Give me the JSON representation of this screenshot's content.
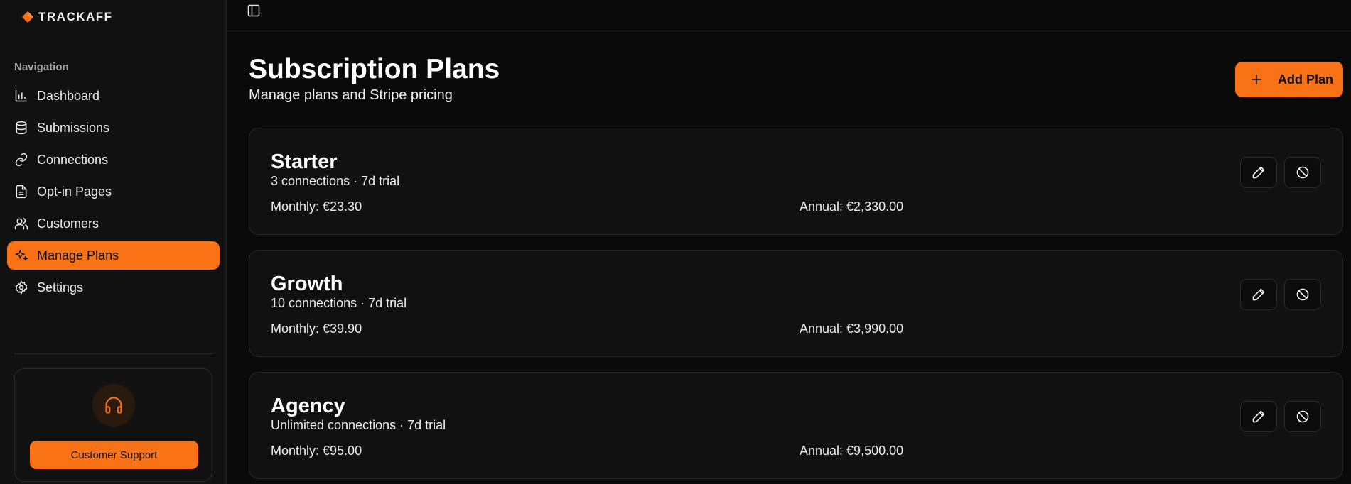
{
  "brand": {
    "name": "TRACKAFF",
    "accent": "#f97316"
  },
  "sidebar": {
    "heading": "Navigation",
    "items": [
      {
        "label": "Dashboard",
        "icon": "bar-chart-icon",
        "active": false
      },
      {
        "label": "Submissions",
        "icon": "database-icon",
        "active": false
      },
      {
        "label": "Connections",
        "icon": "link-icon",
        "active": false
      },
      {
        "label": "Opt-in Pages",
        "icon": "file-text-icon",
        "active": false
      },
      {
        "label": "Customers",
        "icon": "users-icon",
        "active": false
      },
      {
        "label": "Manage Plans",
        "icon": "sparkles-icon",
        "active": true
      },
      {
        "label": "Settings",
        "icon": "gear-icon",
        "active": false
      }
    ],
    "support": {
      "icon": "headphones-icon",
      "button_label": "Customer Support"
    }
  },
  "header": {
    "title": "Subscription Plans",
    "subtitle": "Manage plans and Stripe pricing",
    "add_button_label": "Add Plan"
  },
  "plans": [
    {
      "name": "Starter",
      "meta": "3 connections · 7d trial",
      "monthly": "Monthly: €23.30",
      "annual": "Annual: €2,330.00"
    },
    {
      "name": "Growth",
      "meta": "10 connections · 7d trial",
      "monthly": "Monthly: €39.90",
      "annual": "Annual: €3,990.00"
    },
    {
      "name": "Agency",
      "meta": "Unlimited connections · 7d trial",
      "monthly": "Monthly: €95.00",
      "annual": "Annual: €9,500.00"
    }
  ]
}
